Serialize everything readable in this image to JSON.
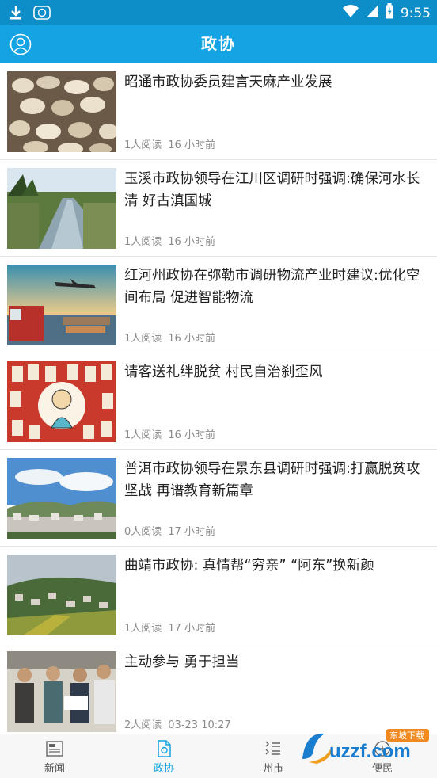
{
  "status_bar": {
    "time": "9:55"
  },
  "header": {
    "title": "政协"
  },
  "news": [
    {
      "headline": "昭通市政协委员建言天麻产业发展",
      "reads": "1人阅读",
      "time": "16 小时前"
    },
    {
      "headline": "玉溪市政协领导在江川区调研时强调:确保河水长清 好古滇国城",
      "reads": "1人阅读",
      "time": "16 小时前"
    },
    {
      "headline": "红河州政协在弥勒市调研物流产业时建议:优化空间布局 促进智能物流",
      "reads": "1人阅读",
      "time": "16 小时前"
    },
    {
      "headline": "请客送礼绊脱贫  村民自治刹歪风",
      "reads": "1人阅读",
      "time": "16 小时前"
    },
    {
      "headline": "普洱市政协领导在景东县调研时强调:打赢脱贫攻坚战 再谱教育新篇章",
      "reads": "0人阅读",
      "time": "17 小时前"
    },
    {
      "headline": "曲靖市政协: 真情帮“穷亲” “阿东”换新颜",
      "reads": "1人阅读",
      "time": "17 小时前"
    },
    {
      "headline": "主动参与  勇于担当",
      "reads": "2人阅读",
      "time": "03-23 10:27"
    }
  ],
  "tabs": [
    {
      "label": "新闻",
      "icon": "news-icon"
    },
    {
      "label": "政协",
      "icon": "document-icon",
      "active": true
    },
    {
      "label": "州市",
      "icon": "list-icon"
    },
    {
      "label": "便民",
      "icon": "service-icon"
    }
  ],
  "watermark": {
    "text": "uzzf.com",
    "badge": "东坡下载"
  },
  "colors": {
    "status_bar": "#0e8ec9",
    "app_bar": "#14a3e3",
    "active_tab": "#14a3e3"
  }
}
